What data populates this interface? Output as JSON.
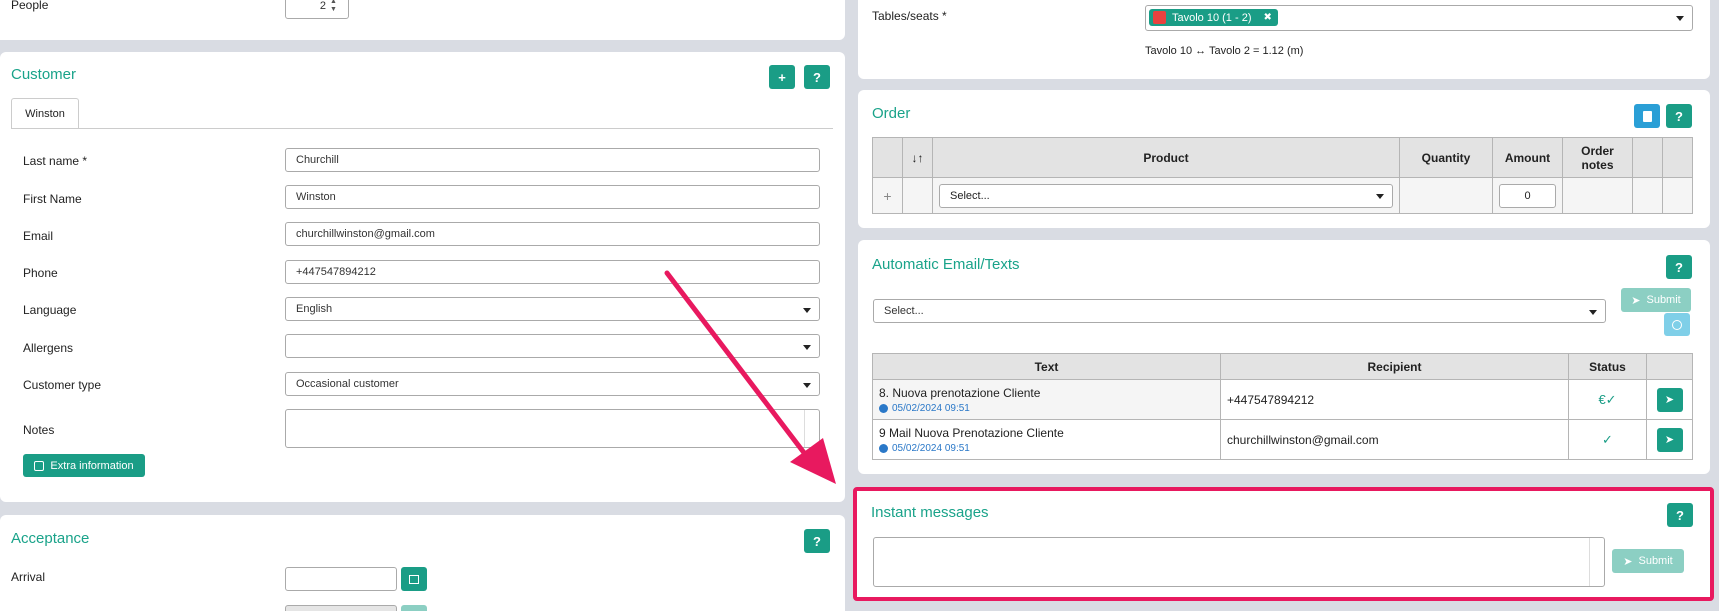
{
  "people": {
    "label": "People",
    "value": "2"
  },
  "customer": {
    "title": "Customer",
    "add_icon": "+",
    "help_icon": "?",
    "tab": "Winston",
    "fields": {
      "last_name": {
        "label": "Last name",
        "required": "*",
        "value": "Churchill"
      },
      "first_name": {
        "label": "First Name",
        "value": "Winston"
      },
      "email": {
        "label": "Email",
        "value": "churchillwinston@gmail.com"
      },
      "phone": {
        "label": "Phone",
        "value": "+447547894212"
      },
      "language": {
        "label": "Language",
        "value": "English"
      },
      "allergens": {
        "label": "Allergens",
        "value": ""
      },
      "customer_type": {
        "label": "Customer type",
        "value": "Occasional customer"
      },
      "notes": {
        "label": "Notes",
        "value": ""
      }
    },
    "extra_info_label": "Extra information"
  },
  "acceptance": {
    "title": "Acceptance",
    "help_icon": "?",
    "arrival_label": "Arrival",
    "arrival_value": ""
  },
  "tables": {
    "label": "Tables/seats",
    "required": "*",
    "chip_label": "Tavolo 10 (1 - 2)",
    "chip_remove": "✖",
    "distance_info": "Tavolo 10 ↔ Tavolo 2 = 1.12 (m)"
  },
  "order": {
    "title": "Order",
    "help_icon": "?",
    "columns": [
      "",
      "↓↑",
      "Product",
      "Quantity",
      "Amount",
      "Order notes",
      "",
      ""
    ],
    "row": {
      "add": "+",
      "product_placeholder": "Select...",
      "amount": "0"
    }
  },
  "auto_email": {
    "title": "Automatic Email/Texts",
    "help_icon": "?",
    "select_placeholder": "Select...",
    "submit_label": "Submit",
    "columns": [
      "Text",
      "Recipient",
      "Status",
      ""
    ],
    "rows": [
      {
        "text": "8. Nuova prenotazione Cliente",
        "time": "05/02/2024 09:51",
        "recipient": "+447547894212",
        "status": "€✓"
      },
      {
        "text": "9 Mail Nuova Prenotazione Cliente",
        "time": "05/02/2024 09:51",
        "recipient": "churchillwinston@gmail.com",
        "status": "✓"
      }
    ]
  },
  "instant": {
    "title": "Instant messages",
    "help_icon": "?",
    "message_value": "",
    "submit_label": "Submit"
  },
  "colors": {
    "accent": "#1a9d86",
    "highlight": "#e8195f",
    "disabled": "#8ccfc3"
  }
}
